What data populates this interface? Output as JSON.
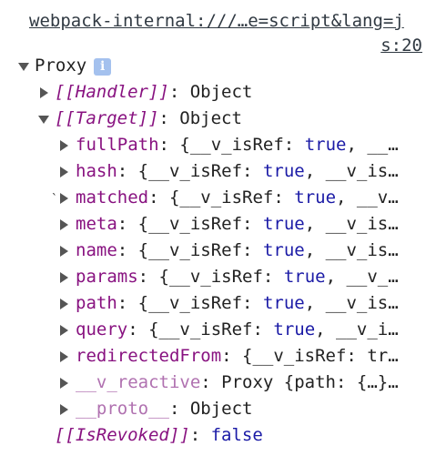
{
  "source": {
    "line1": "webpack-internal:///…e=script&lang=j",
    "line2": "s:20"
  },
  "root": {
    "label": "Proxy",
    "info_glyph": "i"
  },
  "handler": {
    "key": "[[Handler]]",
    "value": "Object"
  },
  "target": {
    "key": "[[Target]]",
    "value": "Object"
  },
  "props": [
    {
      "key": "fullPath",
      "preview": "{__v_isRef: true, __…"
    },
    {
      "key": "hash",
      "preview": "{__v_isRef: true, __v_is…"
    },
    {
      "key": "matched",
      "preview": "{__v_isRef: true, __v…"
    },
    {
      "key": "meta",
      "preview": "{__v_isRef: true, __v_is…"
    },
    {
      "key": "name",
      "preview": "{__v_isRef: true, __v_is…"
    },
    {
      "key": "params",
      "preview": "{__v_isRef: true, __v_…"
    },
    {
      "key": "path",
      "preview": "{__v_isRef: true, __v_is…"
    },
    {
      "key": "query",
      "preview": "{__v_isRef: true, __v_i…"
    },
    {
      "key": "redirectedFrom",
      "preview": "{__v_isRef: tr…"
    }
  ],
  "reactive": {
    "key": "__v_reactive",
    "preview": "Proxy {path: {…}…"
  },
  "proto": {
    "key": "__proto__",
    "value": "Object"
  },
  "revoked": {
    "key": "[[IsRevoked]]",
    "value": "false"
  },
  "prefix_value": "{__v_isRef: ",
  "colors": {
    "key": "#881280",
    "bool": "#1a1aa6",
    "info": "#a4c1ee"
  }
}
